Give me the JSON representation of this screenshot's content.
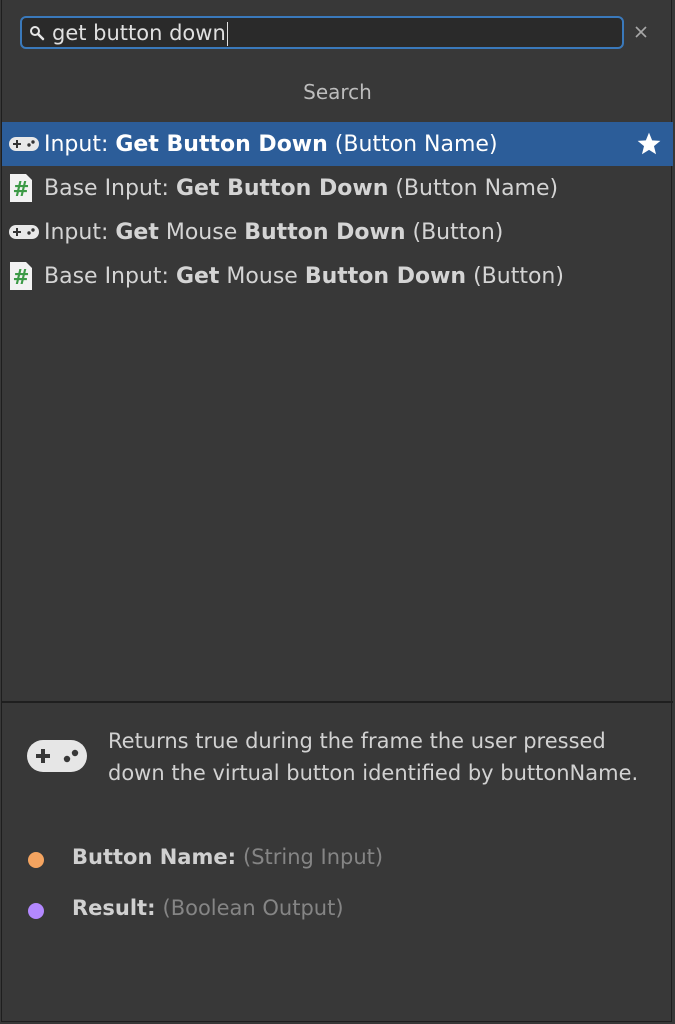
{
  "search": {
    "query": "get button down",
    "header": "Search"
  },
  "results": [
    {
      "icon": "gamepad-icon",
      "selected": true,
      "favorite": true,
      "parts": [
        {
          "text": "Input: ",
          "bold": false
        },
        {
          "text": "Get Button Down",
          "bold": true
        },
        {
          "text": " (Button Name)",
          "bold": false
        }
      ]
    },
    {
      "icon": "csharp-script-icon",
      "selected": false,
      "favorite": false,
      "parts": [
        {
          "text": "Base Input: ",
          "bold": false
        },
        {
          "text": "Get Button Down",
          "bold": true
        },
        {
          "text": " (Button Name)",
          "bold": false
        }
      ]
    },
    {
      "icon": "gamepad-icon",
      "selected": false,
      "favorite": false,
      "parts": [
        {
          "text": "Input: ",
          "bold": false
        },
        {
          "text": "Get",
          "bold": true
        },
        {
          "text": " Mouse ",
          "bold": false
        },
        {
          "text": "Button Down",
          "bold": true
        },
        {
          "text": " (Button)",
          "bold": false
        }
      ]
    },
    {
      "icon": "csharp-script-icon",
      "selected": false,
      "favorite": false,
      "parts": [
        {
          "text": "Base Input: ",
          "bold": false
        },
        {
          "text": "Get",
          "bold": true
        },
        {
          "text": " Mouse ",
          "bold": false
        },
        {
          "text": "Button Down",
          "bold": true
        },
        {
          "text": " (Button)",
          "bold": false
        }
      ]
    }
  ],
  "details": {
    "icon": "gamepad-icon",
    "description": "Returns true during the frame the user pressed down the virtual button identified by buttonName.",
    "ports": [
      {
        "name": "Button Name:",
        "type": "(String Input)",
        "color": "#f4a460"
      },
      {
        "name": "Result:",
        "type": "(Boolean Output)",
        "color": "#b388ff"
      }
    ]
  },
  "colors": {
    "background": "#383838",
    "selection": "#2c5d99",
    "search_border": "#3a79bb",
    "csharp_icon": "#3c9a46"
  }
}
